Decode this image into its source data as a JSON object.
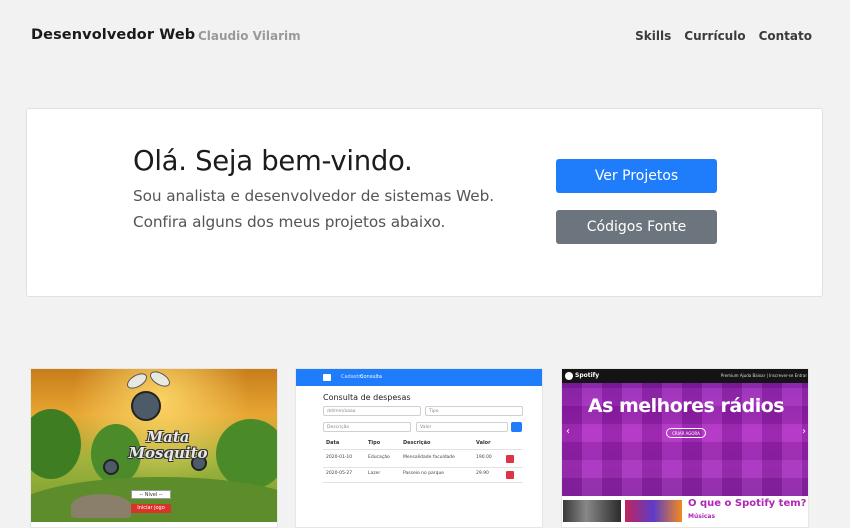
{
  "navbar": {
    "brand": "Desenvolvedor Web",
    "subtitle": "Claudio Vilarim",
    "links": [
      "Skills",
      "Currículo",
      "Contato"
    ]
  },
  "hero": {
    "title": "Olá. Seja bem-vindo.",
    "line1": "Sou analista e desenvolvedor de sistemas Web.",
    "line2": "Confira alguns dos meus projetos abaixo.",
    "primary_button": "Ver Projetos",
    "secondary_button": "Códigos Fonte"
  },
  "projects": {
    "game": {
      "title": "Mata Mosquito",
      "select": "-- Nível --",
      "start": "Iniciar jogo"
    },
    "expenses": {
      "nav": [
        "Cadastro",
        "Consulta"
      ],
      "title": "Consulta de despesas",
      "date_placeholder": "dd/mm/aaaa",
      "type_placeholder": "Tipo",
      "desc_placeholder": "Descrição",
      "value_placeholder": "Valor",
      "columns": [
        "Data",
        "Tipo",
        "Descrição",
        "Valor"
      ],
      "rows": [
        [
          "2020-01-10",
          "Educação",
          "Mensalidade faculdade",
          "190.00"
        ],
        [
          "2020-05-27",
          "Lazer",
          "Passeio no parque",
          "29.90"
        ]
      ]
    },
    "spotify": {
      "brand": "Spotify",
      "nav": "Premium   Ajuda   Baixar   |   Inscrever-se   Entrar",
      "headline": "As melhores rádios",
      "cta": "CRIAR AGORA",
      "question": "O que o Spotify tem?",
      "subheading": "Músicas"
    }
  },
  "colors": {
    "primary": "#1f7dfc",
    "secondary": "#6c757d",
    "background": "#f2f2f2",
    "spotify_purple": "#b026b8"
  }
}
